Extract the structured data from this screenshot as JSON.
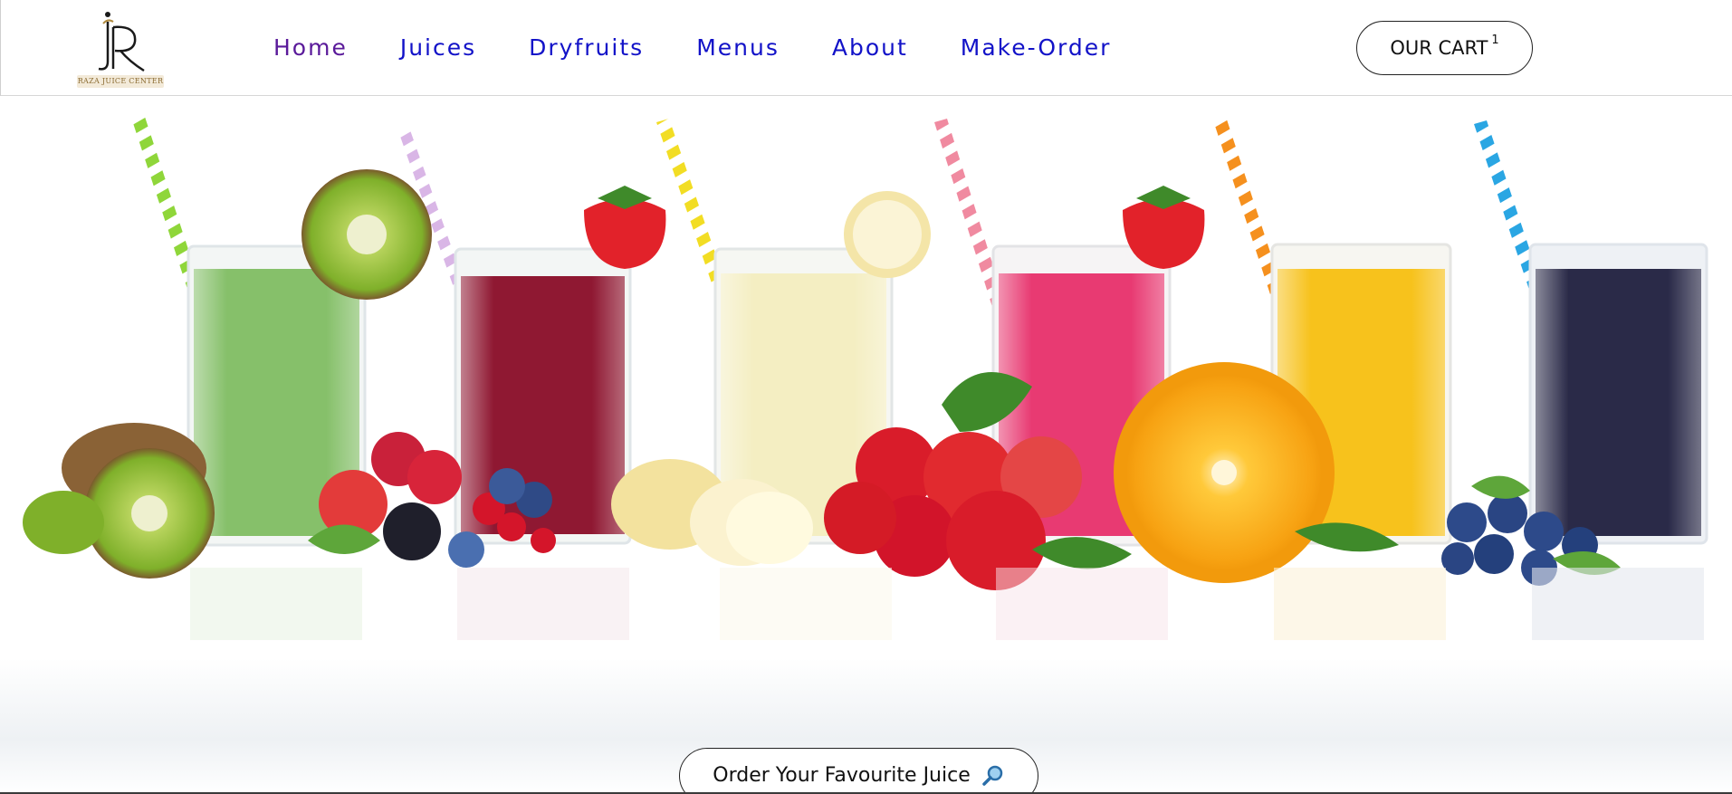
{
  "brand": {
    "logo_letters": "R",
    "name": "Raza Juice Center"
  },
  "nav": {
    "items": [
      {
        "label": "Home",
        "active": true
      },
      {
        "label": "Juices",
        "active": false
      },
      {
        "label": "Dryfruits",
        "active": false
      },
      {
        "label": "Menus",
        "active": false
      },
      {
        "label": "About",
        "active": false
      },
      {
        "label": "Make-Order",
        "active": false
      }
    ]
  },
  "cart": {
    "label": "OUR CART",
    "count": "1"
  },
  "hero": {
    "image_subject": "six glasses of fruit juice with kiwi, berries, banana, strawberries, orange and blueberries",
    "cta_label": "Order Your Favourite Juice",
    "cta_icon": "magnifier-icon"
  },
  "colors": {
    "nav_link": "#1212c8",
    "nav_active": "#5a1a9a",
    "brand_gold": "#8a6a2f"
  }
}
